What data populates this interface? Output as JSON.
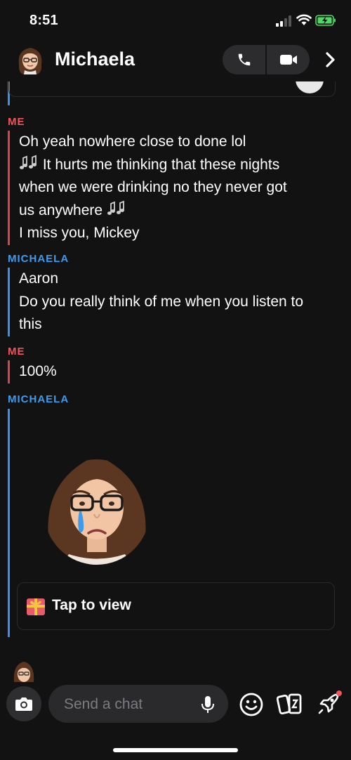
{
  "status_bar": {
    "time": "8:51"
  },
  "header": {
    "contact_name": "Michaela"
  },
  "messages": [
    {
      "sender": "ME",
      "lines": [
        "Oh yeah nowhere close to done lol",
        " It hurts me thinking that these nights",
        "when we were drinking no they never got",
        "us anywhere ",
        "I miss you, Mickey"
      ]
    },
    {
      "sender": "MICHAELA",
      "lines": [
        "Aaron",
        "Do you really think of me when you listen to",
        "this"
      ]
    },
    {
      "sender": "ME",
      "lines": [
        "100%"
      ]
    },
    {
      "sender": "MICHAELA",
      "snap_label": "Tap to view"
    }
  ],
  "composer": {
    "placeholder": "Send a chat"
  },
  "colors": {
    "me": "#f2545b",
    "her": "#3d9cf0",
    "background": "#121212"
  },
  "icons": [
    "phone-icon",
    "video-icon",
    "chevron-right-icon",
    "camera-icon",
    "mic-icon",
    "emoji-icon",
    "cards-icon",
    "rocket-icon",
    "music-notes-icon",
    "gift-icon"
  ]
}
